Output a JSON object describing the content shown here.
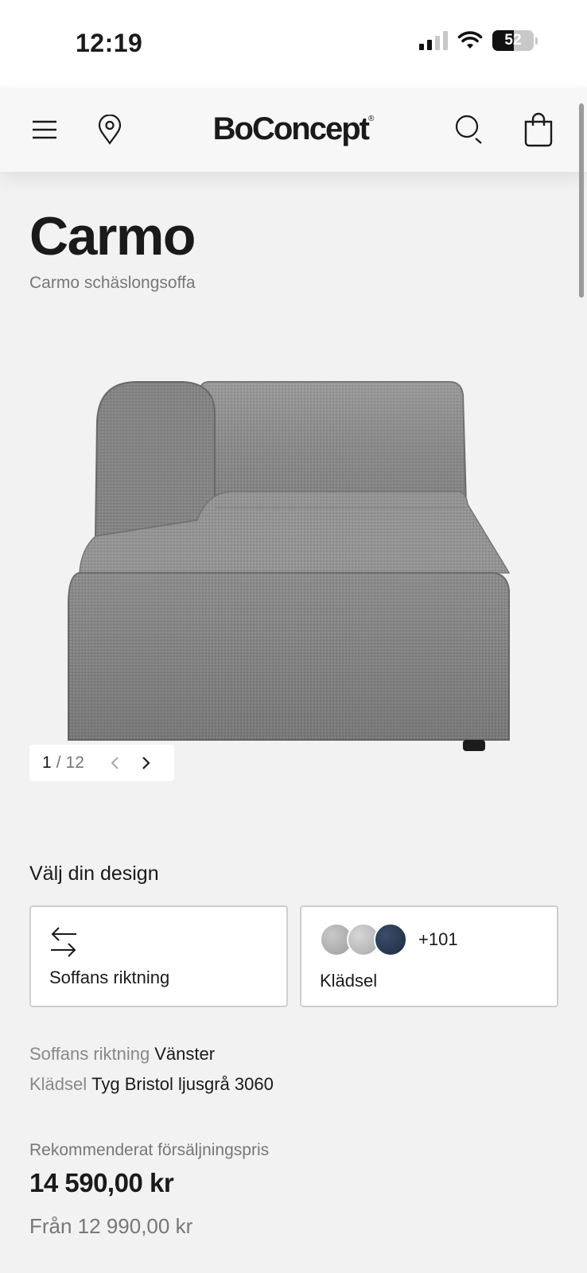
{
  "status_bar": {
    "time": "12:19",
    "battery": "52",
    "battery_level": 0.52,
    "signal_bars_active": 2,
    "signal_bars_total": 4
  },
  "header": {
    "logo": "BoConcept",
    "logo_mark": "®",
    "icons": [
      "menu-icon",
      "location-pin-icon",
      "search-icon",
      "shopping-bag-icon"
    ]
  },
  "product": {
    "title": "Carmo",
    "subtitle": "Carmo schäslongsoffa"
  },
  "gallery": {
    "current": "1",
    "separator": "/",
    "total": "12"
  },
  "design": {
    "heading": "Välj din design",
    "direction_card_label": "Soffans riktning",
    "upholstery_card_label": "Klädsel",
    "upholstery_more": "+101",
    "swatch_colors": [
      "#a2a2a2",
      "#bdbdbd",
      "#25354e"
    ]
  },
  "selection": {
    "direction_key": "Soffans riktning",
    "direction_value": "Vänster",
    "upholstery_key": "Klädsel",
    "upholstery_value": "Tyg Bristol ljusgrå 3060"
  },
  "price": {
    "label": "Rekommenderat försäljningspris",
    "value": "14 590,00 kr",
    "from": "Från 12 990,00 kr"
  },
  "colors": {
    "background": "#f2f2f2",
    "text": "#1a1a1a",
    "muted": "#777777",
    "fabric": "#8a8a8a"
  }
}
